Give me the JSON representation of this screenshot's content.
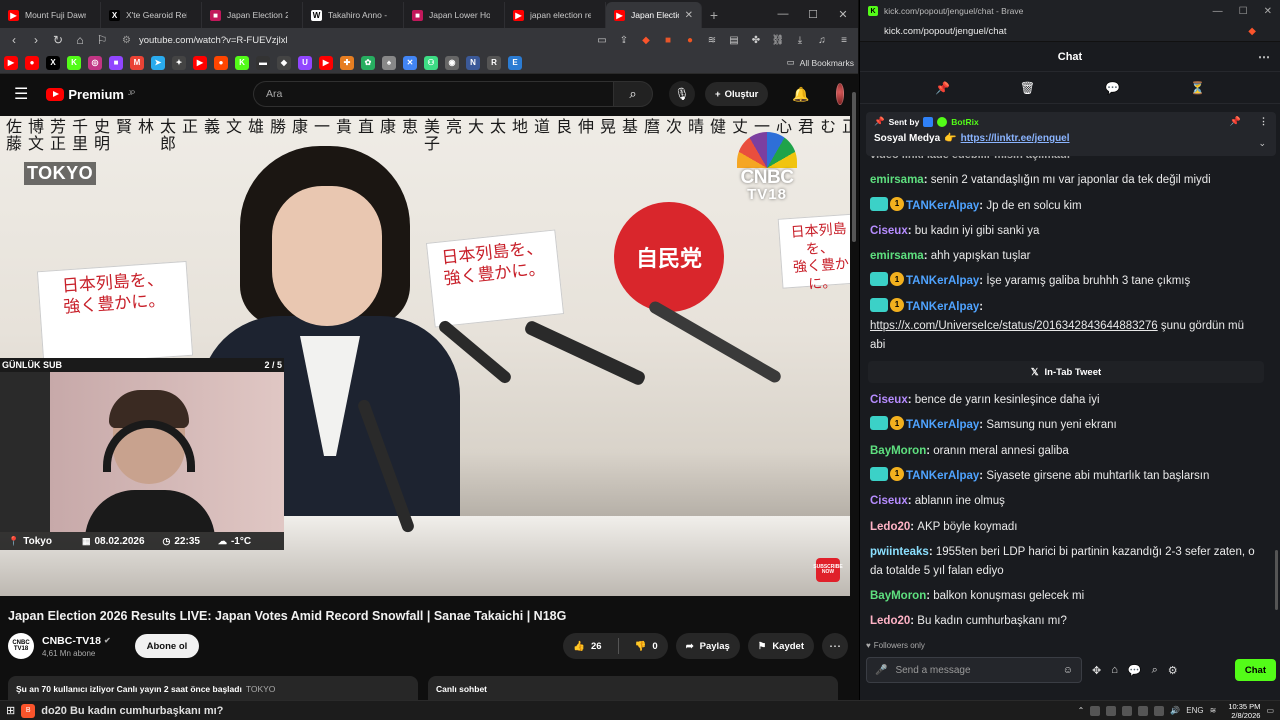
{
  "left_browser": {
    "tabs": [
      {
        "title": "Mount Fuji Dawn D",
        "icon": "youtube-icon",
        "color": "#ff0000",
        "glyph": "▶"
      },
      {
        "title": "X'te Gearoid Reidy",
        "icon": "x-icon",
        "color": "#000000",
        "glyph": "X"
      },
      {
        "title": "Japan Election 2026",
        "icon": "news-icon",
        "color": "#c2185b",
        "glyph": "■"
      },
      {
        "title": "Takahiro Anno - W",
        "icon": "wikipedia-icon",
        "color": "#ffffff",
        "glyph": "W"
      },
      {
        "title": "Japan Lower House",
        "icon": "news-icon",
        "color": "#c2185b",
        "glyph": "■"
      },
      {
        "title": "japan election resul",
        "icon": "youtube-icon",
        "color": "#ff0000",
        "glyph": "▶"
      },
      {
        "title": "Japan Electio",
        "icon": "youtube-icon",
        "color": "#ff0000",
        "glyph": "▶",
        "active": true
      }
    ],
    "url": "youtube.com/watch?v=R-FUEVzjlxl",
    "bookmarks_label": "All Bookmarks",
    "bookmark_icons": [
      {
        "name": "youtube-bookmark-icon",
        "color": "#ff0000",
        "glyph": "▶"
      },
      {
        "name": "youtube-music-bookmark-icon",
        "color": "#ff0000",
        "glyph": "●"
      },
      {
        "name": "x-bookmark-icon",
        "color": "#000000",
        "glyph": "X"
      },
      {
        "name": "kick-bookmark-icon",
        "color": "#53fc18",
        "glyph": "K"
      },
      {
        "name": "instagram-bookmark-icon",
        "color": "#c13584",
        "glyph": "◎"
      },
      {
        "name": "twitch-bookmark-icon",
        "color": "#9146ff",
        "glyph": "■"
      },
      {
        "name": "gmail-bookmark-icon",
        "color": "#ea4335",
        "glyph": "M"
      },
      {
        "name": "telegram-bookmark-icon",
        "color": "#2aabee",
        "glyph": "➤"
      },
      {
        "name": "star-bookmark-icon",
        "color": "#444444",
        "glyph": "✦"
      },
      {
        "name": "youtube-bookmark-icon-2",
        "color": "#ff0000",
        "glyph": "▶"
      },
      {
        "name": "reddit-bookmark-icon",
        "color": "#ff4500",
        "glyph": "●"
      },
      {
        "name": "kick-bookmark-icon-2",
        "color": "#53fc18",
        "glyph": "K"
      },
      {
        "name": "terminal-bookmark-icon",
        "color": "#333333",
        "glyph": "▬"
      },
      {
        "name": "diamond-bookmark-icon",
        "color": "#444444",
        "glyph": "◆"
      },
      {
        "name": "twitch-bookmark-icon-2",
        "color": "#9146ff",
        "glyph": "U"
      },
      {
        "name": "youtube-bookmark-icon-3",
        "color": "#ff0000",
        "glyph": "▶"
      },
      {
        "name": "game-bookmark-icon",
        "color": "#e67e22",
        "glyph": "✚"
      },
      {
        "name": "leaf-bookmark-icon",
        "color": "#27ae60",
        "glyph": "✿"
      },
      {
        "name": "bell-bookmark-icon",
        "color": "#888888",
        "glyph": "♠"
      },
      {
        "name": "translate-bookmark-icon",
        "color": "#4285f4",
        "glyph": "✕"
      },
      {
        "name": "android-bookmark-icon",
        "color": "#3ddc84",
        "glyph": "⚇"
      },
      {
        "name": "globe-bookmark-icon",
        "color": "#666666",
        "glyph": "◉"
      },
      {
        "name": "n-bookmark-icon",
        "color": "#3b5998",
        "glyph": "N"
      },
      {
        "name": "r-bookmark-icon",
        "color": "#555555",
        "glyph": "R"
      },
      {
        "name": "e-bookmark-icon",
        "color": "#2b7cd3",
        "glyph": "E"
      }
    ]
  },
  "youtube": {
    "logo_text": "Premium",
    "logo_region": "JP",
    "search_placeholder": "Ara",
    "create_label": "Oluştur",
    "video": {
      "names": [
        "佐藤",
        "博文",
        "芳正",
        "千里",
        "史明",
        "賢",
        "林",
        "太郎",
        "正",
        "義",
        "文",
        "雄",
        "勝",
        "康",
        "一",
        "貴",
        "直",
        "康",
        "恵",
        "美子",
        "亮",
        "大",
        "太",
        "地",
        "道",
        "良",
        "伸",
        "晃",
        "基",
        "麿",
        "次",
        "晴",
        "健",
        "丈",
        "一早",
        "心",
        "君",
        "む",
        "正",
        "熊",
        "輝",
        "茂",
        "木"
      ],
      "poster_text": "日本列島を、\n強く豊かに。",
      "party_mark": "自民党",
      "tokyo_label": "TOKYO",
      "cnbc_line1": "CNBC",
      "cnbc_line2": "TV18",
      "gunluk_sub": "GÜNLÜK SUB",
      "sub_progress": "2 / 5",
      "location": "Tokyo",
      "date": "08.02.2026",
      "time": "22:35",
      "weather": "-1°C",
      "subscribe_now": "SUBSCRIBE NOW"
    },
    "title": "Japan Election 2026 Results LIVE: Japan Votes Amid Record Snowfall | Sanae Takaichi | N18G",
    "channel": {
      "name": "CNBC-TV18",
      "subscribers": "4,61 Mn abone",
      "avatar_text": "CNBC TV18",
      "subscribe_label": "Abone ol"
    },
    "likes": "26",
    "dislikes": "0",
    "share_label": "Paylaş",
    "save_label": "Kaydet",
    "description": "Şu an 70 kullanıcı izliyor  Canlı yayın 2 saat önce başladı",
    "description_location": "TOKYO",
    "live_chat_label": "Canlı sohbet"
  },
  "kick": {
    "window_title": "kick.com/popout/jenguel/chat - Brave",
    "url": "kick.com/popout/jenguel/chat",
    "chat_title": "Chat",
    "pinned": {
      "sent_by": "Sent by",
      "bot_name": "BotRix",
      "label": "Sosyal Medya",
      "link": "https://linktr.ee/jenguel"
    },
    "clipped_line": "video linki iade edebilir misin açılmadı",
    "messages": [
      {
        "user": "emirsama",
        "color": "#5ee07f",
        "text": "senin 2 vatandaşlığın mı var japonlar da tek değil miydi",
        "badges": false
      },
      {
        "user": "TANKerAlpay",
        "color": "#4fa3ff",
        "text": "Jp de en solcu kim",
        "badges": true
      },
      {
        "user": "Ciseux",
        "color": "#b68cff",
        "text": "bu kadın iyi gibi sanki ya",
        "badges": false
      },
      {
        "user": "emirsama",
        "color": "#5ee07f",
        "text": "ahh yapışkan tuşlar",
        "badges": false
      },
      {
        "user": "TANKerAlpay",
        "color": "#4fa3ff",
        "text": "İşe yaramış galiba bruhhh 3 tane çıkmış",
        "badges": true
      },
      {
        "user": "TANKerAlpay",
        "color": "#4fa3ff",
        "text": "",
        "badges": true,
        "link": "https://x.com/UniverseIce/status/2016342843644883276",
        "after": " şunu gördün mü abi"
      }
    ],
    "tweet_bar": "In-Tab Tweet",
    "messages2": [
      {
        "user": "Ciseux",
        "color": "#b68cff",
        "text": "bence de yarın kesinleşince daha iyi",
        "badges": false
      },
      {
        "user": "TANKerAlpay",
        "color": "#4fa3ff",
        "text": "Samsung nun yeni ekranı",
        "badges": true
      },
      {
        "user": "BayMoron",
        "color": "#5ee07f",
        "text": "oranın meral annesi galiba",
        "badges": false
      },
      {
        "user": "TANKerAlpay",
        "color": "#4fa3ff",
        "text": "Siyasete girsene abi muhtarlık tan başlarsın",
        "badges": true
      },
      {
        "user": "Ciseux",
        "color": "#b68cff",
        "text": "ablanın ine olmuş",
        "badges": false
      },
      {
        "user": "Ledo20",
        "color": "#ffb3c6",
        "text": "AKP böyle koymadı",
        "badges": false
      },
      {
        "user": "pwiinteaks",
        "color": "#8be0ff",
        "text": "1955ten beri LDP harici bi partinin kazandığı 2-3 sefer zaten, o da totalde 5 yıl falan ediyo",
        "badges": false
      },
      {
        "user": "BayMoron",
        "color": "#5ee07f",
        "text": "balkon konuşması gelecek mi",
        "badges": false
      },
      {
        "user": "Ledo20",
        "color": "#ffb3c6",
        "text": "Bu kadın cumhurbaşkanı mı?",
        "badges": false
      }
    ],
    "followers_only": "Followers only",
    "input_placeholder": "Send a message",
    "send_label": "Chat",
    "badge_number": "1"
  },
  "taskbar": {
    "ticker": "do20 Bu kadın cumhurbaşkanı mı?",
    "lang": "ENG",
    "time": "10:35 PM",
    "date": "2/8/2026"
  }
}
